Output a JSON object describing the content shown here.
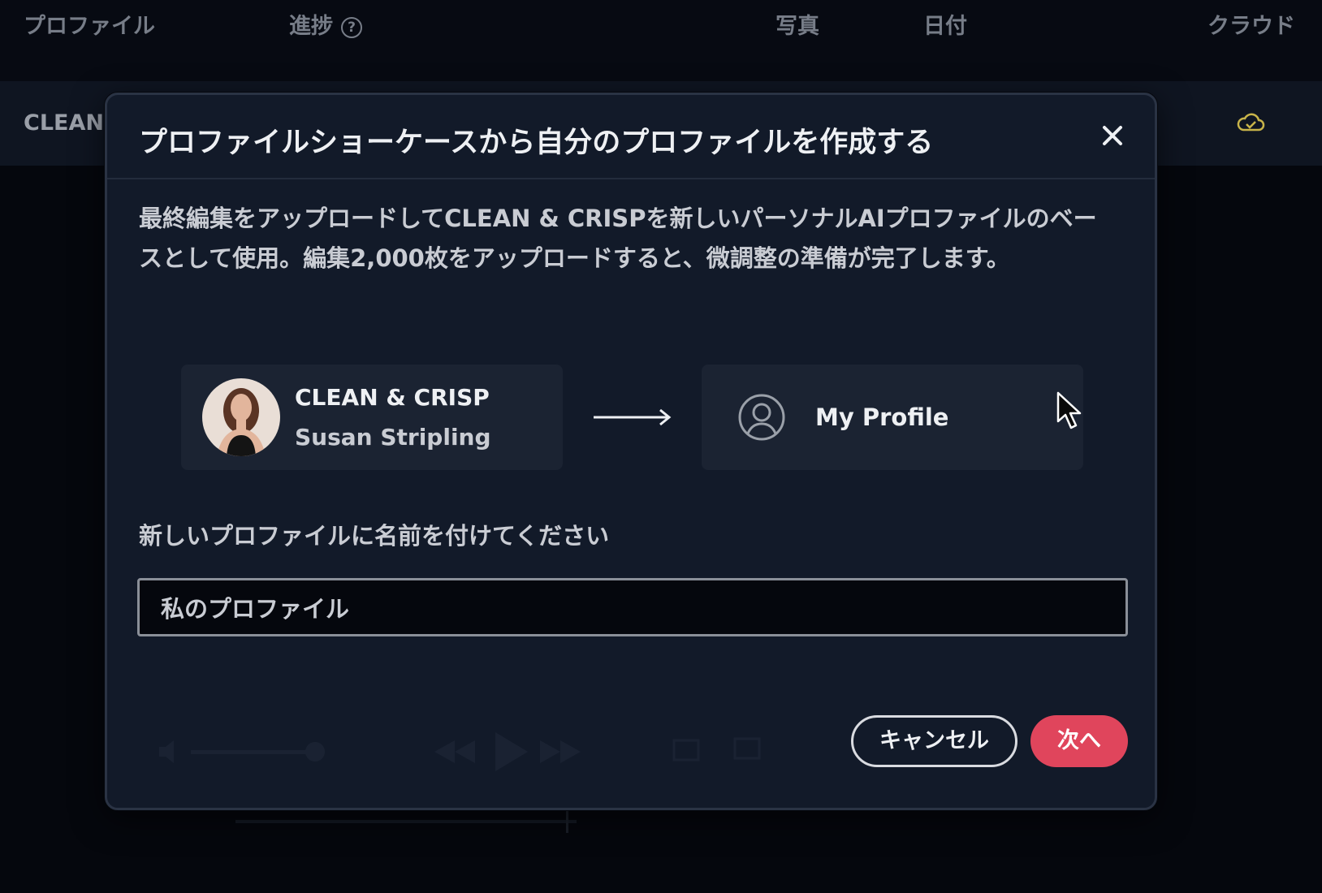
{
  "background": {
    "columns": {
      "profile": "プロファイル",
      "progress": "進捗",
      "photos": "写真",
      "date": "日付",
      "cloud": "クラウド"
    },
    "row_name": "CLEAN &"
  },
  "modal": {
    "title": "プロファイルショーケースから自分のプロファイルを作成する",
    "description": "最終編集をアップロードしてCLEAN & CRISPを新しいパーソナルAIプロファイルのベースとして使用。編集2,000枚をアップロードすると、微調整の準備が完了します。",
    "source": {
      "name": "CLEAN & CRISP",
      "author": "Susan Stripling"
    },
    "target": {
      "name": "My Profile"
    },
    "field_label": "新しいプロファイルに名前を付けてください",
    "input_value": "私のプロファイル",
    "cancel_label": "キャンセル",
    "next_label": "次へ"
  },
  "colors": {
    "accent": "#e0455c",
    "modal_bg": "#121a29",
    "card_bg": "#1b2332",
    "cloud_icon": "#c8b44a"
  },
  "icons": [
    "help-icon",
    "close-icon",
    "cloud-check-icon",
    "arrow-right-icon",
    "user-circle-icon",
    "cursor-icon"
  ]
}
